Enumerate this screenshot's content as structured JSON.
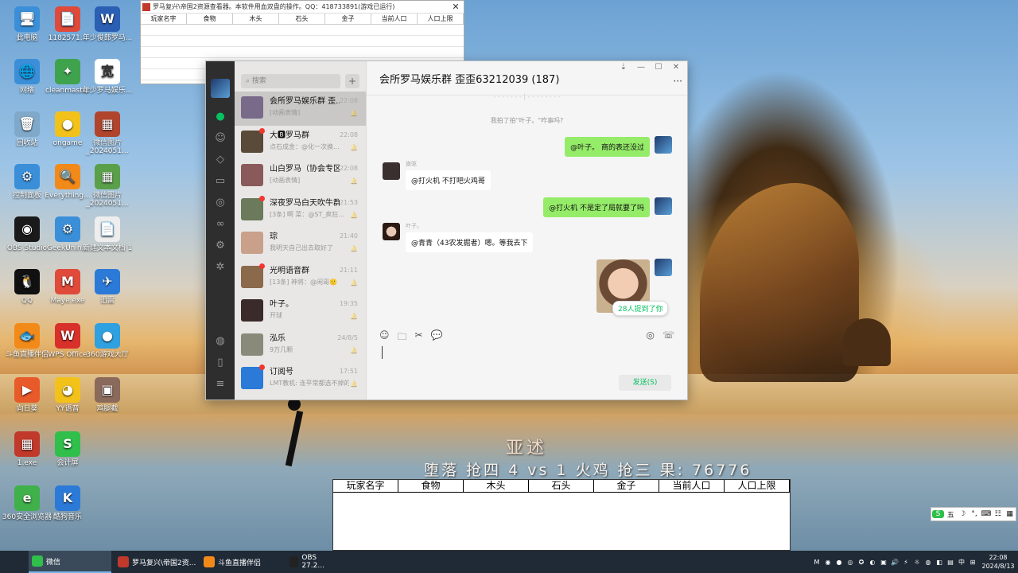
{
  "desktop_icons": [
    {
      "label": "此电脑",
      "glyph": "🖥",
      "color": "#3a8fd8"
    },
    {
      "label": "1182571...",
      "glyph": "📄",
      "color": "#e04a3a"
    },
    {
      "label": "年少俊郎罗马...",
      "glyph": "W",
      "color": "#2b5fb4"
    },
    {
      "label": "网络",
      "glyph": "🌐",
      "color": "#3a8fd8"
    },
    {
      "label": "cleanmaster",
      "glyph": "✦",
      "color": "#3fa34d"
    },
    {
      "label": "年少罗马娱乐...",
      "glyph": "宽",
      "color": "#ffffff"
    },
    {
      "label": "回收站",
      "glyph": "🗑",
      "color": "#7fa8c9"
    },
    {
      "label": "ongame",
      "glyph": "●",
      "color": "#f2c21a"
    },
    {
      "label": "微信图片_2024051...",
      "glyph": "▦",
      "color": "#b0442c"
    },
    {
      "label": "控制面板",
      "glyph": "⚙",
      "color": "#3a8fd8"
    },
    {
      "label": "Everything...",
      "glyph": "🔍",
      "color": "#f28a1a"
    },
    {
      "label": "微信图片_2024051...",
      "glyph": "▦",
      "color": "#5aa04a"
    },
    {
      "label": "OBS Studio",
      "glyph": "◉",
      "color": "#1a1a1a"
    },
    {
      "label": "GeekUnin...",
      "glyph": "⚙",
      "color": "#3a8fd8"
    },
    {
      "label": "新建文本文档 1",
      "glyph": "📄",
      "color": "#eeeeee"
    },
    {
      "label": "QQ",
      "glyph": "🐧",
      "color": "#111111"
    },
    {
      "label": "Maye.exe",
      "glyph": "M",
      "color": "#e04a3a"
    },
    {
      "label": "迅雷",
      "glyph": "✈",
      "color": "#2b7ad8"
    },
    {
      "label": "斗鱼直播伴侣",
      "glyph": "🐟",
      "color": "#f28a1a"
    },
    {
      "label": "WPS Office",
      "glyph": "W",
      "color": "#d8302a"
    },
    {
      "label": "360游戏大厅",
      "glyph": "●",
      "color": "#2fa0e0"
    },
    {
      "label": "向日葵",
      "glyph": "▶",
      "color": "#e85a2a"
    },
    {
      "label": "YY语音",
      "glyph": "◕",
      "color": "#f2c21a"
    },
    {
      "label": "鸡腿截",
      "glyph": "▣",
      "color": "#8a6a5a"
    },
    {
      "label": "1.exe",
      "glyph": "▦",
      "color": "#c0392b"
    },
    {
      "label": "会计屏",
      "glyph": "S",
      "color": "#2fbf4a"
    },
    {
      "label": "360安全浏览器",
      "glyph": "e",
      "color": "#3fb04a"
    },
    {
      "label": "酷狗音乐",
      "glyph": "K",
      "color": "#2b7ad8"
    }
  ],
  "small_window": {
    "title": "罗马复兴\\帝国2资源查看器。本软件用血双盘的操作。QQ：418733891(游戏已运行)",
    "close": "✕",
    "columns": [
      "玩家名字",
      "食物",
      "木头",
      "石头",
      "金子",
      "当前人口",
      "人口上限"
    ]
  },
  "overlay": {
    "line1": "亚述",
    "line2": "堕落  抢四 4 vs 1 火鸡 抢三   果: 76776"
  },
  "game_table": {
    "columns": [
      "玩家名字",
      "食物",
      "木头",
      "石头",
      "金子",
      "当前人口",
      "人口上限"
    ]
  },
  "chat": {
    "search_placeholder": "搜索",
    "plus": "+",
    "title": "会所罗马娱乐群 歪歪63212039 (187)",
    "window_controls": [
      "⇣",
      "—",
      "☐",
      "✕"
    ],
    "more": "···",
    "conversations": [
      {
        "name": "会所罗马娱乐群 歪...",
        "time": "22:08",
        "preview": "[动画表情]",
        "unread": false,
        "selected": true,
        "color": "#7a6a8a"
      },
      {
        "name": "大🅱罗马群",
        "time": "22:08",
        "preview": "点石成金：@化一次换...",
        "unread": true,
        "selected": false,
        "color": "#5a4a3a"
      },
      {
        "name": "山白罗马（协会专区）",
        "time": "22:08",
        "preview": "[动画表情]",
        "unread": false,
        "selected": false,
        "color": "#8a5a5a"
      },
      {
        "name": "深夜罗马白天吹牛群",
        "time": "21:53",
        "preview": "[3条] 啊 菜：@ST_疯狂...",
        "unread": true,
        "selected": false,
        "color": "#6a7a5a"
      },
      {
        "name": "琮",
        "time": "21:40",
        "preview": "我明天自己出去取好了",
        "unread": false,
        "selected": false,
        "color": "#c9a08a"
      },
      {
        "name": "光明语音群",
        "time": "21:11",
        "preview": "[13条] 神将：@闲哥🙂",
        "unread": true,
        "selected": false,
        "color": "#8a6a4a"
      },
      {
        "name": "叶子。",
        "time": "19:35",
        "preview": "开球",
        "unread": false,
        "selected": false,
        "color": "#3a2a2a"
      },
      {
        "name": "泓乐",
        "time": "24/8/5",
        "preview": "9万几颗",
        "unread": false,
        "selected": false,
        "color": "#8a8a7a"
      },
      {
        "name": "订阅号",
        "time": "17:51",
        "preview": "LMT教机: 连平常都选不掉的...",
        "unread": true,
        "selected": false,
        "color": "#2b7ad8"
      }
    ],
    "timeline_hint": "- - - - - - - | - - - - - - - -",
    "system_msg": "我拍了拍\"叶子。\"咋事吗?",
    "messages": [
      {
        "side": "me",
        "text": "@叶子。 商的表还没过"
      },
      {
        "side": "other",
        "sender": "旗驱",
        "text": "@打火机 不打吧火鸡哥"
      },
      {
        "side": "me",
        "text": "@打火机 不是定了局就要了吗"
      },
      {
        "side": "other",
        "sender": "叶子。",
        "text": "@青青（43农发掘者）嗯。等我去下"
      }
    ],
    "mention_badge": "28人提到了你",
    "tool_icons": [
      "☺",
      "🗀",
      "✂",
      "💬"
    ],
    "right_tools": [
      "◎",
      "☏"
    ],
    "send_label": "发送(S)"
  },
  "taskbar": {
    "items": [
      {
        "label": "微信",
        "color": "#2fbf4a",
        "active": true
      },
      {
        "label": "罗马复兴\\帝国2资...",
        "color": "#c0392b",
        "active": false
      },
      {
        "label": "斗鱼直播伴侣",
        "color": "#f28a1a",
        "active": false
      },
      {
        "label": "OBS 27.2...",
        "color": "#222222",
        "active": false
      }
    ],
    "tray_icons": [
      "M",
      "◉",
      "●",
      "◎",
      "✪",
      "◐",
      "▣",
      "🔊",
      "⚡",
      "☼",
      "◍",
      "◧",
      "▤"
    ],
    "ime_label": "中",
    "clock_time": "22:08",
    "clock_date": "2024/8/13"
  },
  "ime_bar": {
    "items": [
      "S",
      "五",
      "☽",
      "°,",
      "⌨",
      "☷",
      "▦"
    ]
  }
}
